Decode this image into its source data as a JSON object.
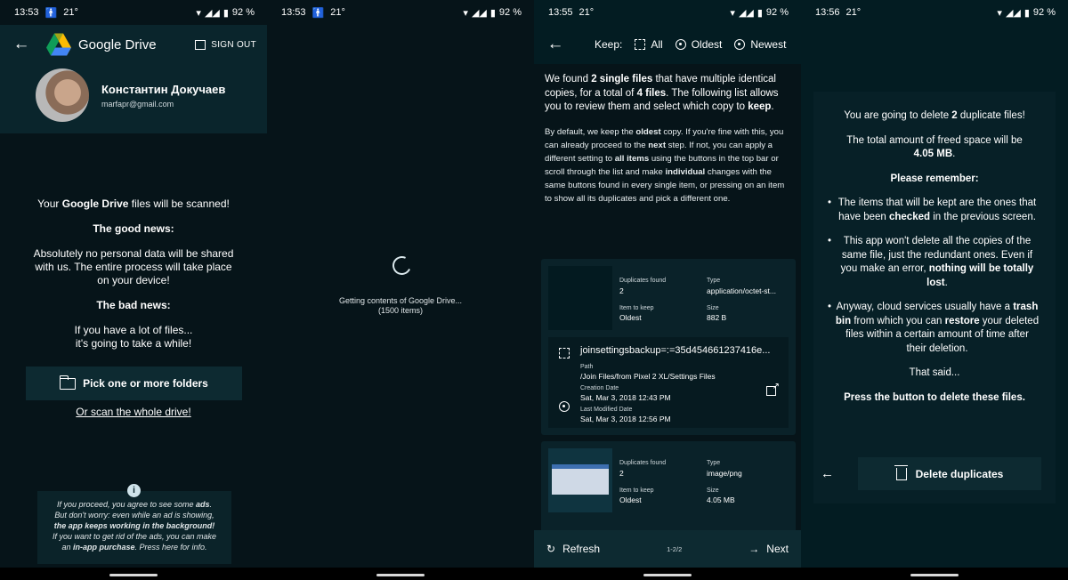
{
  "panel1": {
    "status": {
      "time": "13:53",
      "temp": "21°",
      "battery": "92 %"
    },
    "app_title": "Google Drive",
    "signout_label": "SIGN OUT",
    "user_name": "Константин Докучаев",
    "user_email": "marfapr@gmail.com",
    "scan_line_a": "Your ",
    "scan_line_b": "Google Drive",
    "scan_line_c": " files will be scanned!",
    "good_news_title": "The good news:",
    "good_news_text": "Absolutely no personal data will be shared with us. The entire process will take place on your device!",
    "bad_news_title": "The bad news:",
    "bad_news_line1": "If you have a lot of files...",
    "bad_news_line2": "it's going to take a while!",
    "pick_button": "Pick one or more folders",
    "scan_link": "Or scan the whole drive!",
    "ad_line1a": "If you proceed, you agree to see some ",
    "ad_line1b": "ads",
    "ad_line1c": ".",
    "ad_line2": "But don't worry: even while an ad is showing,",
    "ad_line3": "the app keeps working in the background!",
    "ad_line4": "If you want to get rid of the ads, you can make",
    "ad_line5a": "an ",
    "ad_line5b": "in-app purchase",
    "ad_line5c": ". Press here for info."
  },
  "panel2": {
    "status": {
      "time": "13:53",
      "temp": "21°",
      "battery": "92 %"
    },
    "loading_line1": "Getting contents of Google Drive...",
    "loading_line2": "(1500 items)"
  },
  "panel3": {
    "status": {
      "time": "13:55",
      "temp": "21°",
      "battery": "92 %"
    },
    "keep_label": "Keep:",
    "keep_all": "All",
    "keep_oldest": "Oldest",
    "keep_newest": "Newest",
    "intro_a": "We found ",
    "intro_b": "2 single files",
    "intro_c": " that have multiple identical copies, for a total of ",
    "intro_d": "4 files",
    "intro_e": ". The following list allows you to review them and select which copy to ",
    "intro_f": "keep",
    "intro_g": ".",
    "intro2_a": "By default, we keep the ",
    "intro2_b": "oldest",
    "intro2_c": " copy. If you're fine with this, you can already proceed to the ",
    "intro2_d": "next",
    "intro2_e": " step. If not, you can apply a different setting to ",
    "intro2_f": "all items",
    "intro2_g": " using the buttons in the top bar or scroll through the list and make ",
    "intro2_h": "individual",
    "intro2_i": " changes with the same buttons found in every single item, or pressing on an item to show all its duplicates and pick a different one.",
    "card1": {
      "dup_label": "Duplicates found",
      "dup_value": "2",
      "type_label": "Type",
      "type_value": "application/octet-st...",
      "keep_label": "Item to keep",
      "keep_value": "Oldest",
      "size_label": "Size",
      "size_value": "882 B",
      "file_name": "joinsettingsbackup=:=35d454661237416e...",
      "path_label": "Path",
      "path_value": "/Join Files/from Pixel 2 XL/Settings Files",
      "created_label": "Creation Date",
      "created_value": "Sat, Mar 3, 2018 12:43 PM",
      "modified_label": "Last Modified Date",
      "modified_value": "Sat, Mar 3, 2018 12:56 PM"
    },
    "card2": {
      "dup_label": "Duplicates found",
      "dup_value": "2",
      "type_label": "Type",
      "type_value": "image/png",
      "keep_label": "Item to keep",
      "keep_value": "Oldest",
      "size_label": "Size",
      "size_value": "4.05 MB"
    },
    "refresh_label": "Refresh",
    "page_indicator": "1-2/2",
    "next_label": "Next"
  },
  "panel4": {
    "status": {
      "time": "13:56",
      "temp": "21°",
      "battery": "92 %"
    },
    "line1a": "You are going to delete ",
    "line1b": "2",
    "line1c": " duplicate files!",
    "line2": "The total amount of freed space will be",
    "line2b": "4.05 MB",
    "line2c": ".",
    "remember": "Please remember:",
    "bullet1a": "The items that will be kept are the ones that have been ",
    "bullet1b": "checked",
    "bullet1c": " in the previous screen.",
    "bullet2a": "This app won't delete all the copies of the same file, just the redundant ones. Even if you make an error, ",
    "bullet2b": "nothing will be totally lost",
    "bullet2c": ".",
    "bullet3a": "Anyway, cloud services usually have a ",
    "bullet3b": "trash bin",
    "bullet3c": " from which you can ",
    "bullet3d": "restore",
    "bullet3e": " your deleted files within a certain amount of time after their deletion.",
    "that_said": "That said...",
    "press_button": "Press the button to delete these files.",
    "delete_label": "Delete duplicates"
  }
}
